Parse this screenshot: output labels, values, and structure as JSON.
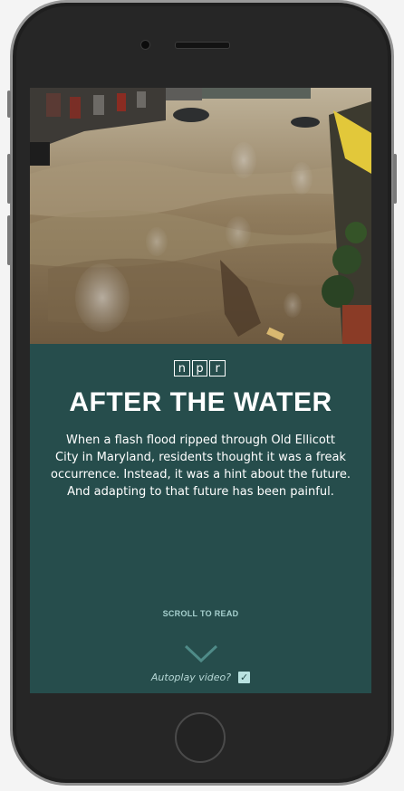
{
  "brand": {
    "logo_letters": [
      "n",
      "p",
      "r"
    ]
  },
  "article": {
    "title": "AFTER THE WATER",
    "dek_lines": [
      "When a flash flood ripped through Old Ellicott",
      "City in Maryland, residents thought it was a freak",
      "occurrence. Instead, it was a hint about the future.",
      "And adapting to that future has been painful."
    ],
    "scroll_label": "SCROLL TO READ"
  },
  "autoplay": {
    "label": "Autoplay video?",
    "checked": true,
    "check_glyph": "✓"
  },
  "icons": {
    "scroll": "chevron-down-icon",
    "checkbox": "check-icon"
  },
  "colors": {
    "panel_bg": "#264d4c",
    "accent": "#a6d0ce",
    "checkbox": "#b9e2e0",
    "text": "#ffffff"
  }
}
